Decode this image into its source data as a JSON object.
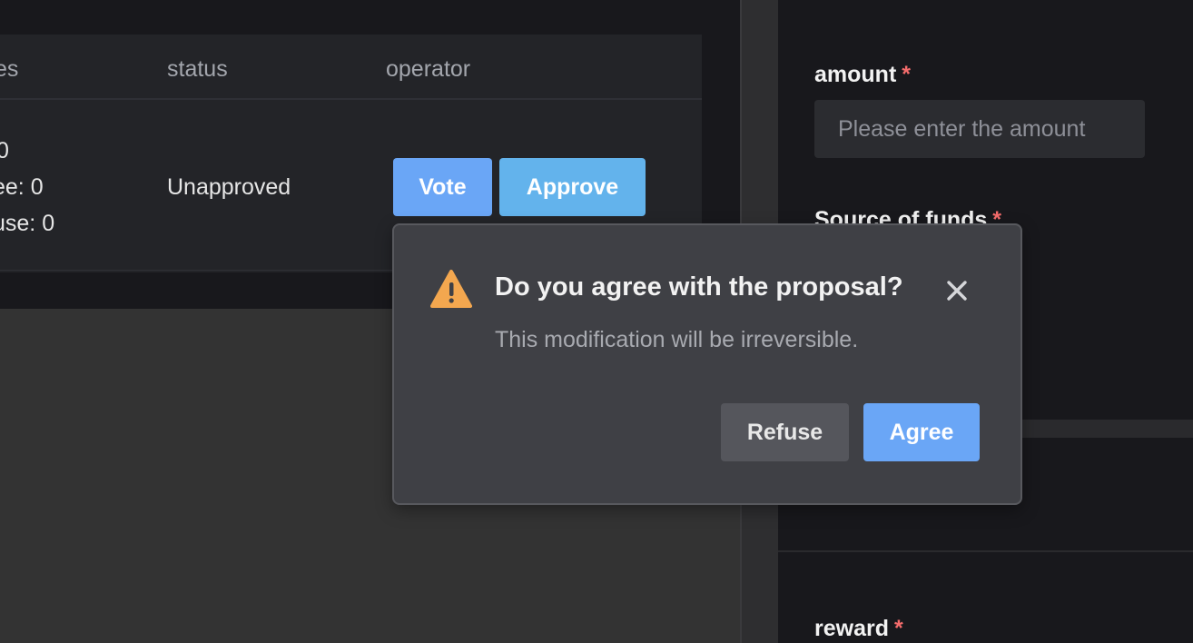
{
  "table": {
    "columns": {
      "votes": "es",
      "status": "status",
      "operator": "operator"
    },
    "row": {
      "votes_lines": [
        "0",
        "ee: 0",
        "use: 0"
      ],
      "status": "Unapproved",
      "vote_label": "Vote",
      "approve_label": "Approve"
    }
  },
  "form": {
    "amount_label": "amount",
    "amount_placeholder": "Please enter the amount",
    "source_label": "Source of funds",
    "reward_label": "reward",
    "required_mark": "*"
  },
  "popconfirm": {
    "icon": "warning-icon",
    "title": "Do you agree with the proposal?",
    "message": "This modification will be irreversible.",
    "refuse_label": "Refuse",
    "agree_label": "Agree"
  },
  "colors": {
    "primary": "#6aa6f6",
    "approve": "#63b3ec",
    "warning": "#f3a74f",
    "required": "#f56c6c"
  }
}
